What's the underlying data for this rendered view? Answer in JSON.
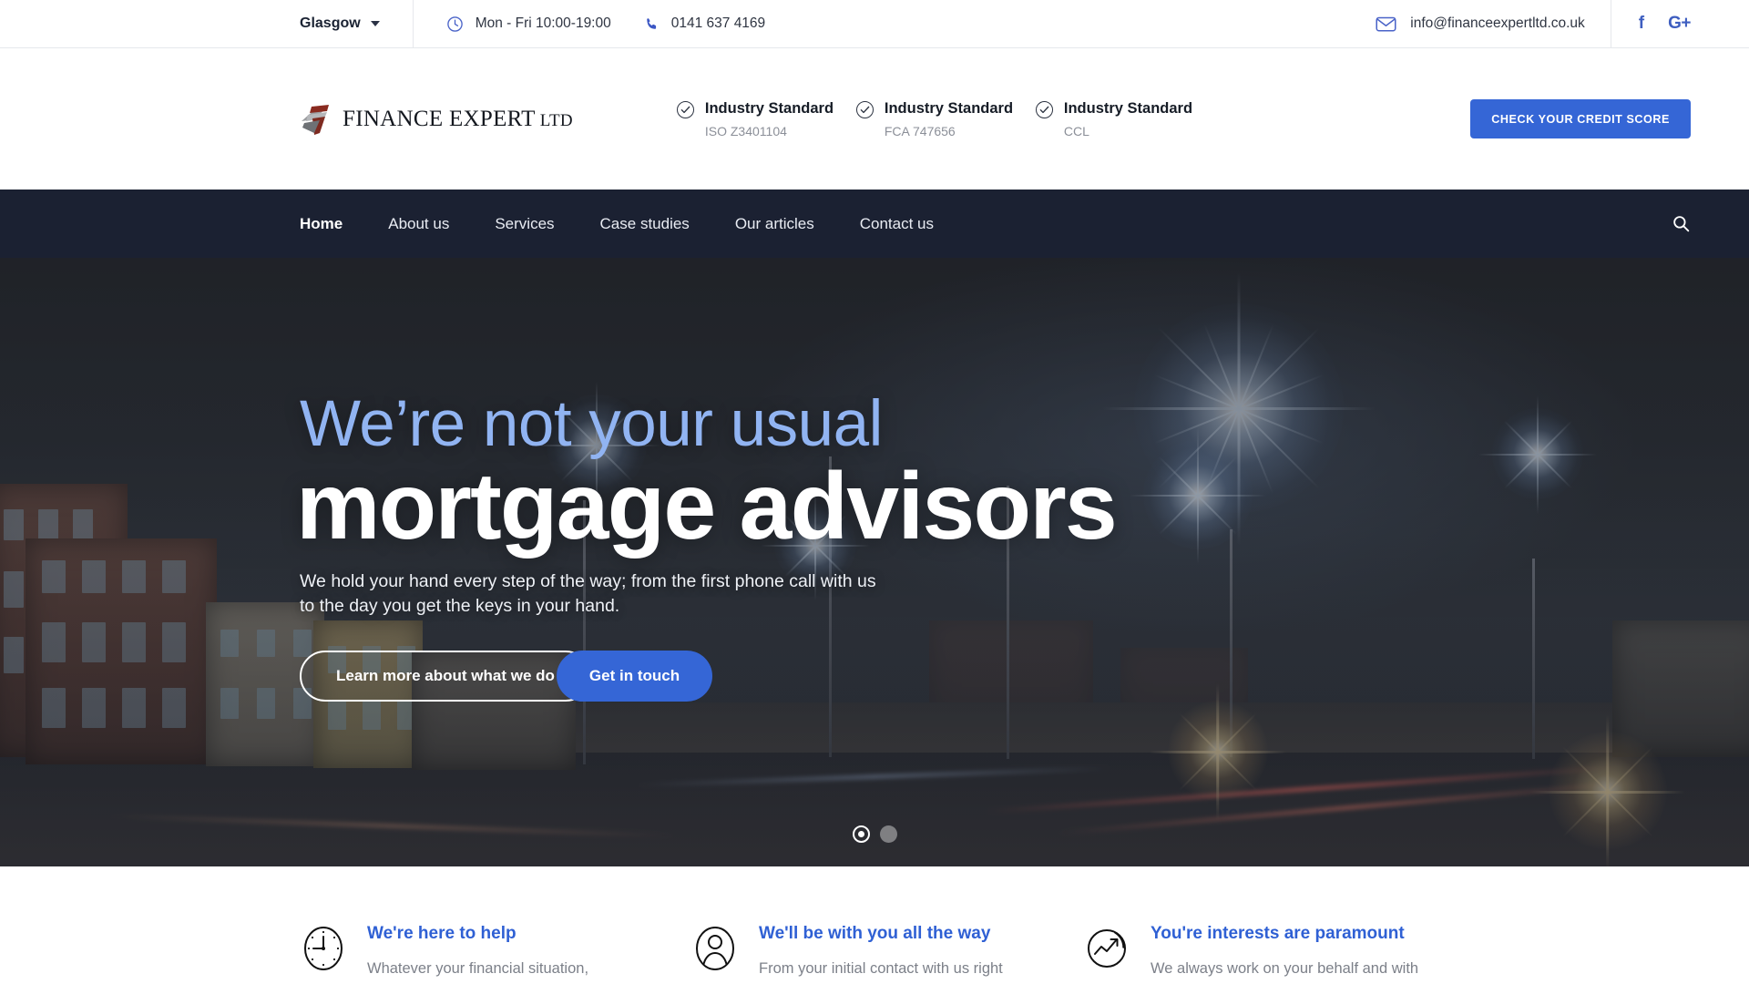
{
  "topbar": {
    "city": "Glasgow",
    "city_caret_icon": "chevron-down-icon",
    "hours_icon": "clock-icon",
    "hours": "Mon - Fri 10:00-19:00",
    "phone_icon": "phone-icon",
    "phone": "0141 637 4169",
    "email_icon": "envelope-icon",
    "email": "info@financeexpertltd.co.uk",
    "facebook_icon": "facebook-icon",
    "facebook_label": "f",
    "googleplus_icon": "google-plus-icon",
    "googleplus_label": "G+"
  },
  "brand": {
    "logo_icon": "finance-expert-logo-mark",
    "name_main": "FINANCE EXPERT",
    "name_suffix": " LTD",
    "badges": [
      {
        "check_icon": "check-circle-icon",
        "title": "Industry Standard",
        "sub": "ISO Z3401104"
      },
      {
        "check_icon": "check-circle-icon",
        "title": "Industry Standard",
        "sub": "FCA 747656"
      },
      {
        "check_icon": "check-circle-icon",
        "title": "Industry Standard",
        "sub": "CCL"
      }
    ],
    "cta_label": "CHECK YOUR CREDIT SCORE",
    "cta_color": "#3566d6"
  },
  "nav": {
    "background": "#1b2132",
    "items": [
      {
        "label": "Home",
        "active": true
      },
      {
        "label": "About us",
        "active": false
      },
      {
        "label": "Services",
        "active": false
      },
      {
        "label": "Case studies",
        "active": false
      },
      {
        "label": "Our articles",
        "active": false
      },
      {
        "label": "Contact us",
        "active": false
      }
    ],
    "search_icon": "search-icon"
  },
  "hero": {
    "headline_light": "We’re not your usual",
    "headline_bold": "mortgage advisors",
    "headline_light_color": "#91b4f2",
    "subtext": "We hold your hand every step of the way; from the first phone call with us to the day you get the keys in your hand.",
    "btn_outline_label": "Learn more about what we do",
    "btn_solid_label": "Get in touch",
    "btn_solid_color": "#3566d6",
    "slide_dots": [
      {
        "name": "slide-dot-1",
        "active": true
      },
      {
        "name": "slide-dot-2",
        "active": false
      }
    ]
  },
  "features": {
    "items": [
      {
        "icon": "clock-icon",
        "title": "We're here to help",
        "desc": "Whatever your financial situation,",
        "title_color": "#2f60d4"
      },
      {
        "icon": "person-icon",
        "title": "We'll be with you all the way",
        "desc": "From your initial contact with us right",
        "title_color": "#2f60d4"
      },
      {
        "icon": "trending-up-chart-icon",
        "title": "You're interests are paramount",
        "desc": "We always work on your behalf and with",
        "title_color": "#2f60d4"
      }
    ]
  }
}
